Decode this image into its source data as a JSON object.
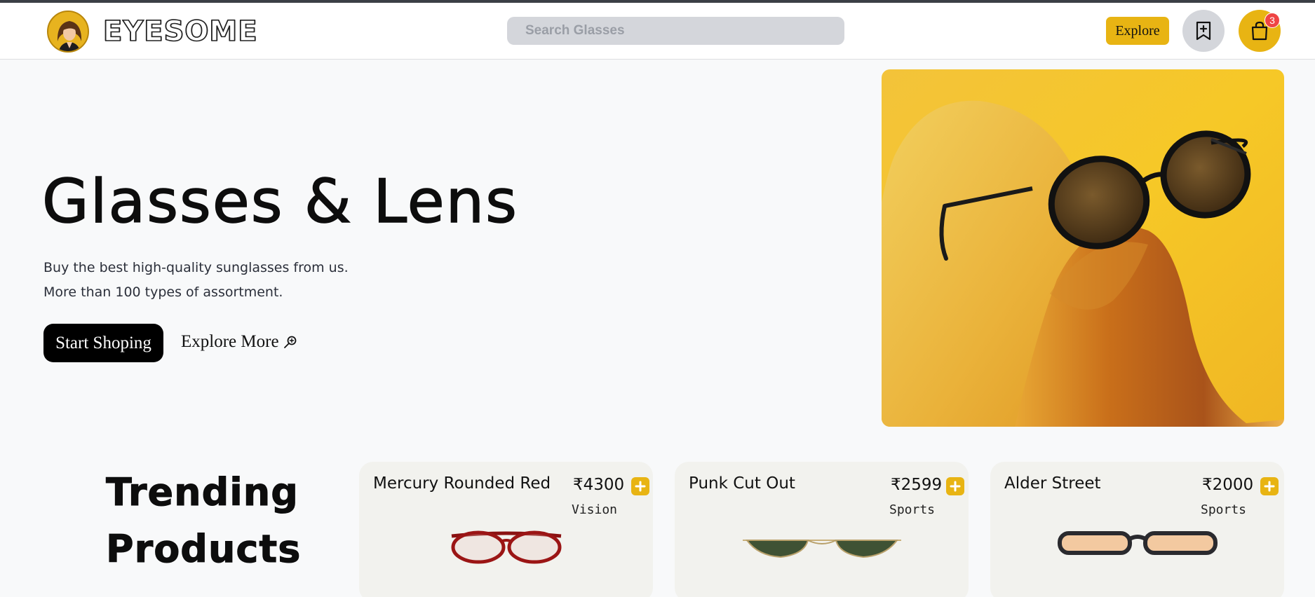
{
  "header": {
    "logo_text": "EYESOME",
    "search_placeholder": "Search Glasses",
    "explore_label": "Explore",
    "cart_count": "3"
  },
  "hero": {
    "title": "Glasses & Lens",
    "subtitle_line1": "Buy the best high-quality sunglasses from us.",
    "subtitle_line2": "More than 100 types of assortment.",
    "start_label": "Start Shoping",
    "explore_more_label": "Explore More"
  },
  "trending": {
    "title_line1": "Trending",
    "title_line2": "Products",
    "products": [
      {
        "name": "Mercury Rounded Red",
        "price": "₹4300",
        "category": "Vision"
      },
      {
        "name": "Punk Cut Out",
        "price": "₹2599",
        "category": "Sports"
      },
      {
        "name": "Alder Street",
        "price": "₹2000",
        "category": "Sports"
      }
    ]
  },
  "colors": {
    "accent": "#e8b413",
    "badge": "#ef4444",
    "dark": "#000000"
  },
  "icons": [
    "bookmark-plus-icon",
    "shopping-bag-icon",
    "search-zoom-icon",
    "plus-icon"
  ]
}
